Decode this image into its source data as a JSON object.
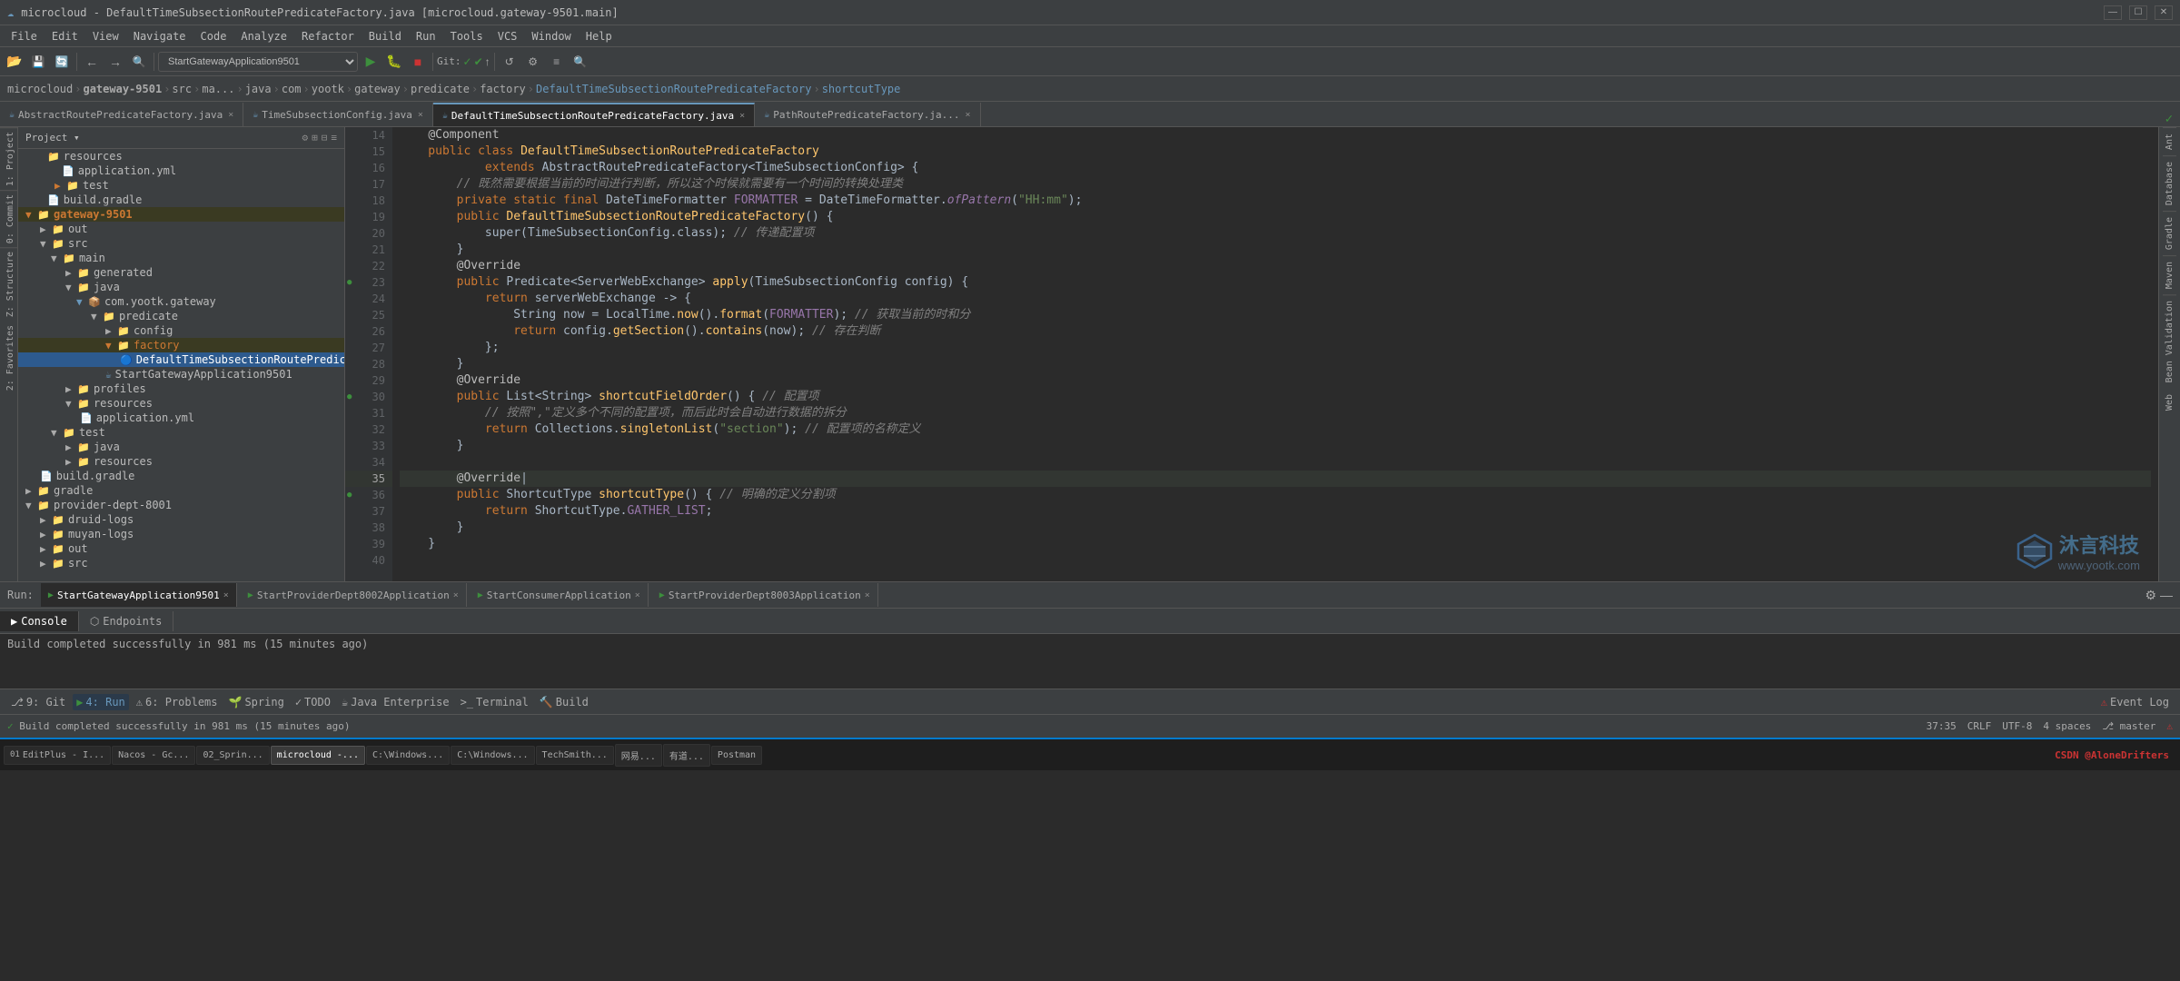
{
  "titleBar": {
    "icon": "☁",
    "title": "microcloud - DefaultTimeSubsectionRoutePredicateFactory.java [microcloud.gateway-9501.main]",
    "controls": [
      "—",
      "☐",
      "✕"
    ]
  },
  "menuBar": {
    "items": [
      "File",
      "Edit",
      "View",
      "Navigate",
      "Code",
      "Analyze",
      "Refactor",
      "Build",
      "Run",
      "Tools",
      "VCS",
      "Window",
      "Help"
    ]
  },
  "toolbar": {
    "runConfig": "StartGatewayApplication9501",
    "buttons": [
      "📁",
      "💾",
      "🔄",
      "←",
      "→",
      "🔍"
    ]
  },
  "breadcrumb": {
    "items": [
      "microcloud",
      "gateway-9501",
      "src",
      "ma...",
      "java",
      "com",
      "yootk",
      "gateway",
      "predicate",
      "factory",
      "DefaultTimeSubsectionRoutePredicateFactory",
      "shortcutType"
    ]
  },
  "tabs": [
    {
      "label": "AbstractRoutePredicateFactory.java",
      "active": false,
      "modified": false
    },
    {
      "label": "TimeSubsectionConfig.java",
      "active": false,
      "modified": false
    },
    {
      "label": "DefaultTimeSubsectionRoutePredicateFactory.java",
      "active": true,
      "modified": false
    },
    {
      "label": "PathRoutePredicateFactory.ja...",
      "active": false,
      "modified": false
    }
  ],
  "projectPanel": {
    "title": "Project",
    "tree": [
      {
        "indent": 1,
        "icon": "📁",
        "label": "resources",
        "type": "folder"
      },
      {
        "indent": 2,
        "icon": "📄",
        "label": "application.yml",
        "type": "file"
      },
      {
        "indent": 2,
        "icon": "📁",
        "label": "test",
        "type": "folder"
      },
      {
        "indent": 1,
        "icon": "📄",
        "label": "build.gradle",
        "type": "file"
      },
      {
        "indent": 0,
        "icon": "📁",
        "label": "gateway-9501",
        "type": "folder",
        "open": true,
        "selected": false
      },
      {
        "indent": 1,
        "icon": "📁",
        "label": "out",
        "type": "folder"
      },
      {
        "indent": 1,
        "icon": "📁",
        "label": "src",
        "type": "folder",
        "open": true
      },
      {
        "indent": 2,
        "icon": "📁",
        "label": "main",
        "type": "folder",
        "open": true
      },
      {
        "indent": 3,
        "icon": "📁",
        "label": "generated",
        "type": "folder"
      },
      {
        "indent": 3,
        "icon": "📁",
        "label": "java",
        "type": "folder",
        "open": true
      },
      {
        "indent": 4,
        "icon": "📦",
        "label": "com.yootk.gateway",
        "type": "package"
      },
      {
        "indent": 5,
        "icon": "📁",
        "label": "predicate",
        "type": "folder",
        "open": true
      },
      {
        "indent": 6,
        "icon": "📁",
        "label": "config",
        "type": "folder"
      },
      {
        "indent": 6,
        "icon": "📁",
        "label": "factory",
        "type": "folder",
        "open": true,
        "highlighted": true
      },
      {
        "indent": 7,
        "icon": "☕",
        "label": "DefaultTimeSubsectionRoutePredic...",
        "type": "java",
        "selected": true
      },
      {
        "indent": 6,
        "icon": "☕",
        "label": "StartGatewayApplication9501",
        "type": "java"
      },
      {
        "indent": 3,
        "icon": "📁",
        "label": "profiles",
        "type": "folder"
      },
      {
        "indent": 3,
        "icon": "📁",
        "label": "resources",
        "type": "folder"
      },
      {
        "indent": 4,
        "icon": "📄",
        "label": "application.yml",
        "type": "file"
      },
      {
        "indent": 2,
        "icon": "📁",
        "label": "test",
        "type": "folder",
        "open": true
      },
      {
        "indent": 3,
        "icon": "📁",
        "label": "java",
        "type": "folder"
      },
      {
        "indent": 3,
        "icon": "📁",
        "label": "resources",
        "type": "folder"
      },
      {
        "indent": 2,
        "icon": "📄",
        "label": "build.gradle",
        "type": "file"
      },
      {
        "indent": 0,
        "icon": "📁",
        "label": "gradle",
        "type": "folder"
      },
      {
        "indent": 0,
        "icon": "📁",
        "label": "provider-dept-8001",
        "type": "folder",
        "open": true
      },
      {
        "indent": 1,
        "icon": "📁",
        "label": "druid-logs",
        "type": "folder"
      },
      {
        "indent": 1,
        "icon": "📁",
        "label": "muyan-logs",
        "type": "folder"
      },
      {
        "indent": 1,
        "icon": "📁",
        "label": "out",
        "type": "folder"
      },
      {
        "indent": 1,
        "icon": "📁",
        "label": "src",
        "type": "folder"
      }
    ]
  },
  "editor": {
    "lines": [
      {
        "num": 14,
        "content": "    @Component",
        "type": "annotation"
      },
      {
        "num": 15,
        "content": "    public class DefaultTimeSubsectionRoutePredicateFactory",
        "type": "code"
      },
      {
        "num": 16,
        "content": "            extends AbstractRoutePredicateFactory<TimeSubsectionConfig> {",
        "type": "code"
      },
      {
        "num": 17,
        "content": "        // 既然需要根据当前的时间进行判断，所以这个时候就需要有一个时间的转换处理类",
        "type": "comment"
      },
      {
        "num": 18,
        "content": "        private static final DateTimeFormatter FORMATTER = DateTimeFormatter.ofPattern(\"HH:mm\");",
        "type": "code"
      },
      {
        "num": 19,
        "content": "        public DefaultTimeSubsectionRoutePredicateFactory() {",
        "type": "code"
      },
      {
        "num": 20,
        "content": "            super(TimeSubsectionConfig.class); // 传递配置项",
        "type": "code"
      },
      {
        "num": 21,
        "content": "        }",
        "type": "code"
      },
      {
        "num": 22,
        "content": "        @Override",
        "type": "annotation"
      },
      {
        "num": 23,
        "content": "        public Predicate<ServerWebExchange> apply(TimeSubsectionConfig config) {",
        "type": "code",
        "hasIcon": true
      },
      {
        "num": 24,
        "content": "            return serverWebExchange -> {",
        "type": "code"
      },
      {
        "num": 25,
        "content": "                String now = LocalTime.now().format(FORMATTER); // 获取当前的时和分",
        "type": "code"
      },
      {
        "num": 26,
        "content": "                return config.getSection().contains(now); // 存在判断",
        "type": "code"
      },
      {
        "num": 27,
        "content": "            };",
        "type": "code"
      },
      {
        "num": 28,
        "content": "        }",
        "type": "code"
      },
      {
        "num": 29,
        "content": "        @Override",
        "type": "annotation"
      },
      {
        "num": 30,
        "content": "        public List<String> shortcutFieldOrder() { // 配置项",
        "type": "code",
        "hasIcon": true
      },
      {
        "num": 31,
        "content": "            // 按照\",\"定义多个不同的配置项，而后此时会自动进行数据的拆分",
        "type": "comment"
      },
      {
        "num": 32,
        "content": "            return Collections.singletonList(\"section\"); // 配置项的名称定义",
        "type": "code"
      },
      {
        "num": 33,
        "content": "        }",
        "type": "code"
      },
      {
        "num": 34,
        "content": "",
        "type": "empty"
      },
      {
        "num": 35,
        "content": "        @Override",
        "type": "annotation",
        "cursor": true
      },
      {
        "num": 36,
        "content": "        public ShortcutType shortcutType() { // 明确的定义分割项",
        "type": "code",
        "hasIcon": true
      },
      {
        "num": 37,
        "content": "            return ShortcutType.GATHER_LIST;",
        "type": "code"
      },
      {
        "num": 38,
        "content": "        }",
        "type": "code"
      },
      {
        "num": 39,
        "content": "    }",
        "type": "code"
      },
      {
        "num": 40,
        "content": "",
        "type": "empty"
      }
    ]
  },
  "runBar": {
    "label": "Run:",
    "tabs": [
      {
        "label": "StartGatewayApplication9501",
        "active": true
      },
      {
        "label": "StartProviderDept8002Application",
        "active": false
      },
      {
        "label": "StartConsumerApplication",
        "active": false
      },
      {
        "label": "StartProviderDept8003Application",
        "active": false
      }
    ]
  },
  "consoleTabs": [
    {
      "label": "Console",
      "active": true,
      "icon": "▶"
    },
    {
      "label": "Endpoints",
      "active": false,
      "icon": "⬡"
    }
  ],
  "consoleMessage": "Build completed successfully in 981 ms (15 minutes ago)",
  "bottomTools": [
    {
      "label": "9: Git",
      "icon": "⎇",
      "active": false
    },
    {
      "label": "4: Run",
      "icon": "▶",
      "active": true
    },
    {
      "label": "6: Problems",
      "icon": "⚠",
      "active": false
    },
    {
      "label": "Spring",
      "icon": "🌱",
      "active": false
    },
    {
      "label": "TODO",
      "icon": "✓",
      "active": false
    },
    {
      "label": "Java Enterprise",
      "icon": "☕",
      "active": false
    },
    {
      "label": "Terminal",
      "icon": ">_",
      "active": false
    },
    {
      "label": "Build",
      "icon": "🔨",
      "active": false
    }
  ],
  "statusBar": {
    "buildStatus": "✓ Build completed successfully in 981 ms (15 minutes ago)",
    "position": "37:35",
    "lineEnding": "CRLF",
    "encoding": "UTF-8",
    "indentation": "4 spaces",
    "branch": "master",
    "errors": "⚠"
  },
  "rightSidebar": {
    "items": [
      "Ant",
      "Database",
      "Gradle",
      "Maven",
      "Bean Validation",
      "Web"
    ]
  },
  "watermark": {
    "logo": "◇",
    "company": "沐言科技",
    "website": "www.yootk.com"
  }
}
